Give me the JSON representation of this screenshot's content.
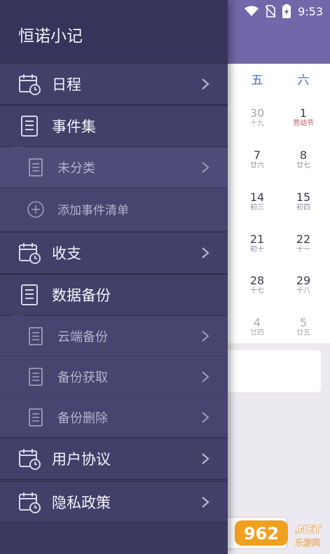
{
  "status_bar": {
    "time": "9:53",
    "icons": [
      "wifi-icon",
      "no-sim-icon",
      "battery-charging-icon"
    ]
  },
  "calendar": {
    "weekdays": [
      "五",
      "六"
    ],
    "weeks": [
      {
        "fri": {
          "num": "30",
          "sub": "十九"
        },
        "sat": {
          "num": "1",
          "sub": "劳动节"
        }
      },
      {
        "fri": {
          "num": "7",
          "sub": "廿六"
        },
        "sat": {
          "num": "8",
          "sub": "廿七"
        }
      },
      {
        "fri": {
          "num": "14",
          "sub": "初三"
        },
        "sat": {
          "num": "15",
          "sub": "初四"
        }
      },
      {
        "fri": {
          "num": "21",
          "sub": "初十"
        },
        "sat": {
          "num": "22",
          "sub": "十一"
        }
      },
      {
        "fri": {
          "num": "28",
          "sub": "十七"
        },
        "sat": {
          "num": "29",
          "sub": "十八"
        }
      },
      {
        "fri": {
          "num": "4",
          "sub": "廿四"
        },
        "sat": {
          "num": "5",
          "sub": "廿五"
        }
      }
    ]
  },
  "drawer": {
    "title": "恒诺小记",
    "items": [
      {
        "label": "日程",
        "icon": "calendar-clock-icon"
      },
      {
        "label": "事件集",
        "icon": "notebook-icon"
      },
      {
        "label": "未分类",
        "icon": "document-icon"
      },
      {
        "label": "添加事件清单",
        "icon": "add-circle-icon"
      },
      {
        "label": "收支",
        "icon": "calendar-clock-icon"
      },
      {
        "label": "数据备份",
        "icon": "notebook-icon"
      },
      {
        "label": "云端备份",
        "icon": "document-icon"
      },
      {
        "label": "备份获取",
        "icon": "document-icon"
      },
      {
        "label": "备份删除",
        "icon": "document-icon"
      },
      {
        "label": "用户协议",
        "icon": "calendar-clock-icon"
      },
      {
        "label": "隐私政策",
        "icon": "calendar-clock-icon"
      }
    ]
  },
  "watermark": {
    "text": "962.NET",
    "sub": "乐游网"
  },
  "colors": {
    "drawer_bg": "#3b3960",
    "header_purple": "#7068a8",
    "weekday_blue": "#3a74c8",
    "holiday_red": "#c05050"
  }
}
